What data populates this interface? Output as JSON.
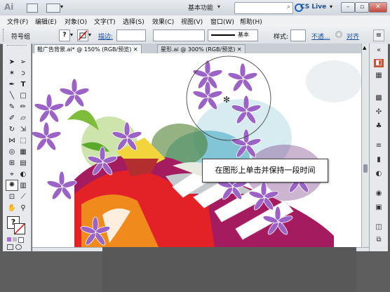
{
  "titlebar": {
    "app_logo": "Ai",
    "workspace": "基本功能",
    "cs_live": "CS Live",
    "win_buttons": [
      "–",
      "▫",
      "✕"
    ]
  },
  "menu": [
    "文件(F)",
    "编辑(E)",
    "对象(O)",
    "文字(T)",
    "选择(S)",
    "效果(C)",
    "视图(V)",
    "窗口(W)",
    "帮助(H)"
  ],
  "control": {
    "group_label": "符号组",
    "question_mark": "?",
    "stroke_label": "描边:",
    "basic_label": "基本",
    "style_label": "样式:",
    "opacity_link": "不透...",
    "align_label": "对齐"
  },
  "tabs": [
    {
      "label": "鞋广告背景.ai* @ 150% (RGB/预览)",
      "close": "✕"
    },
    {
      "label": "星形.ai @ 300% (RGB/预览)",
      "close": "✕"
    }
  ],
  "tools_panel": {
    "fill_question": "?"
  },
  "tooltip_text": "在图形上单击并保持一段时间",
  "colors": {
    "flower": "#9b63c6",
    "shoe_red": "#e32227",
    "shoe_magenta": "#a51b5f",
    "shoe_yellow": "#f2d43c",
    "shoe_orange": "#f08a1c"
  }
}
